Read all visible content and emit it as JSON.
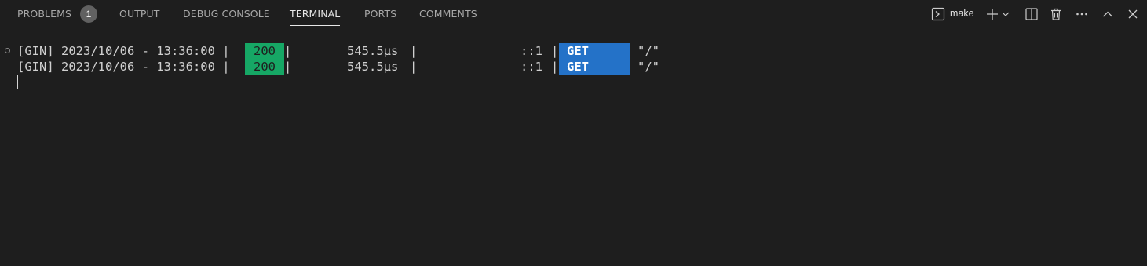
{
  "tabs": [
    {
      "label": "PROBLEMS",
      "active": false
    },
    {
      "label": "OUTPUT",
      "active": false
    },
    {
      "label": "DEBUG CONSOLE",
      "active": false
    },
    {
      "label": "TERMINAL",
      "active": true
    },
    {
      "label": "PORTS",
      "active": false
    },
    {
      "label": "COMMENTS",
      "active": false
    }
  ],
  "problems_count": "1",
  "actions": {
    "terminal_name": "make",
    "icons": [
      "terminal-icon",
      "plus-icon",
      "chevron-down-icon",
      "split-icon",
      "trash-icon",
      "more-icon",
      "chevron-up-icon",
      "close-icon"
    ]
  },
  "terminal": {
    "lines": [
      {
        "prefix": "[GIN] 2023/10/06 - 13:36:00 |",
        "status": "200",
        "sep1": "|",
        "latency": "545.5µs",
        "sep2": "|",
        "client": "::1",
        "sep3": "|",
        "method": "GET",
        "path": "\"/\""
      },
      {
        "prefix": "[GIN] 2023/10/06 - 13:36:00 |",
        "status": "200",
        "sep1": "|",
        "latency": "545.5µs",
        "sep2": "|",
        "client": "::1",
        "sep3": "|",
        "method": "GET",
        "path": "\"/\""
      }
    ]
  },
  "colors": {
    "background": "#1e1e1e",
    "status_ok": "#16a765",
    "method_get": "#2472c8"
  }
}
